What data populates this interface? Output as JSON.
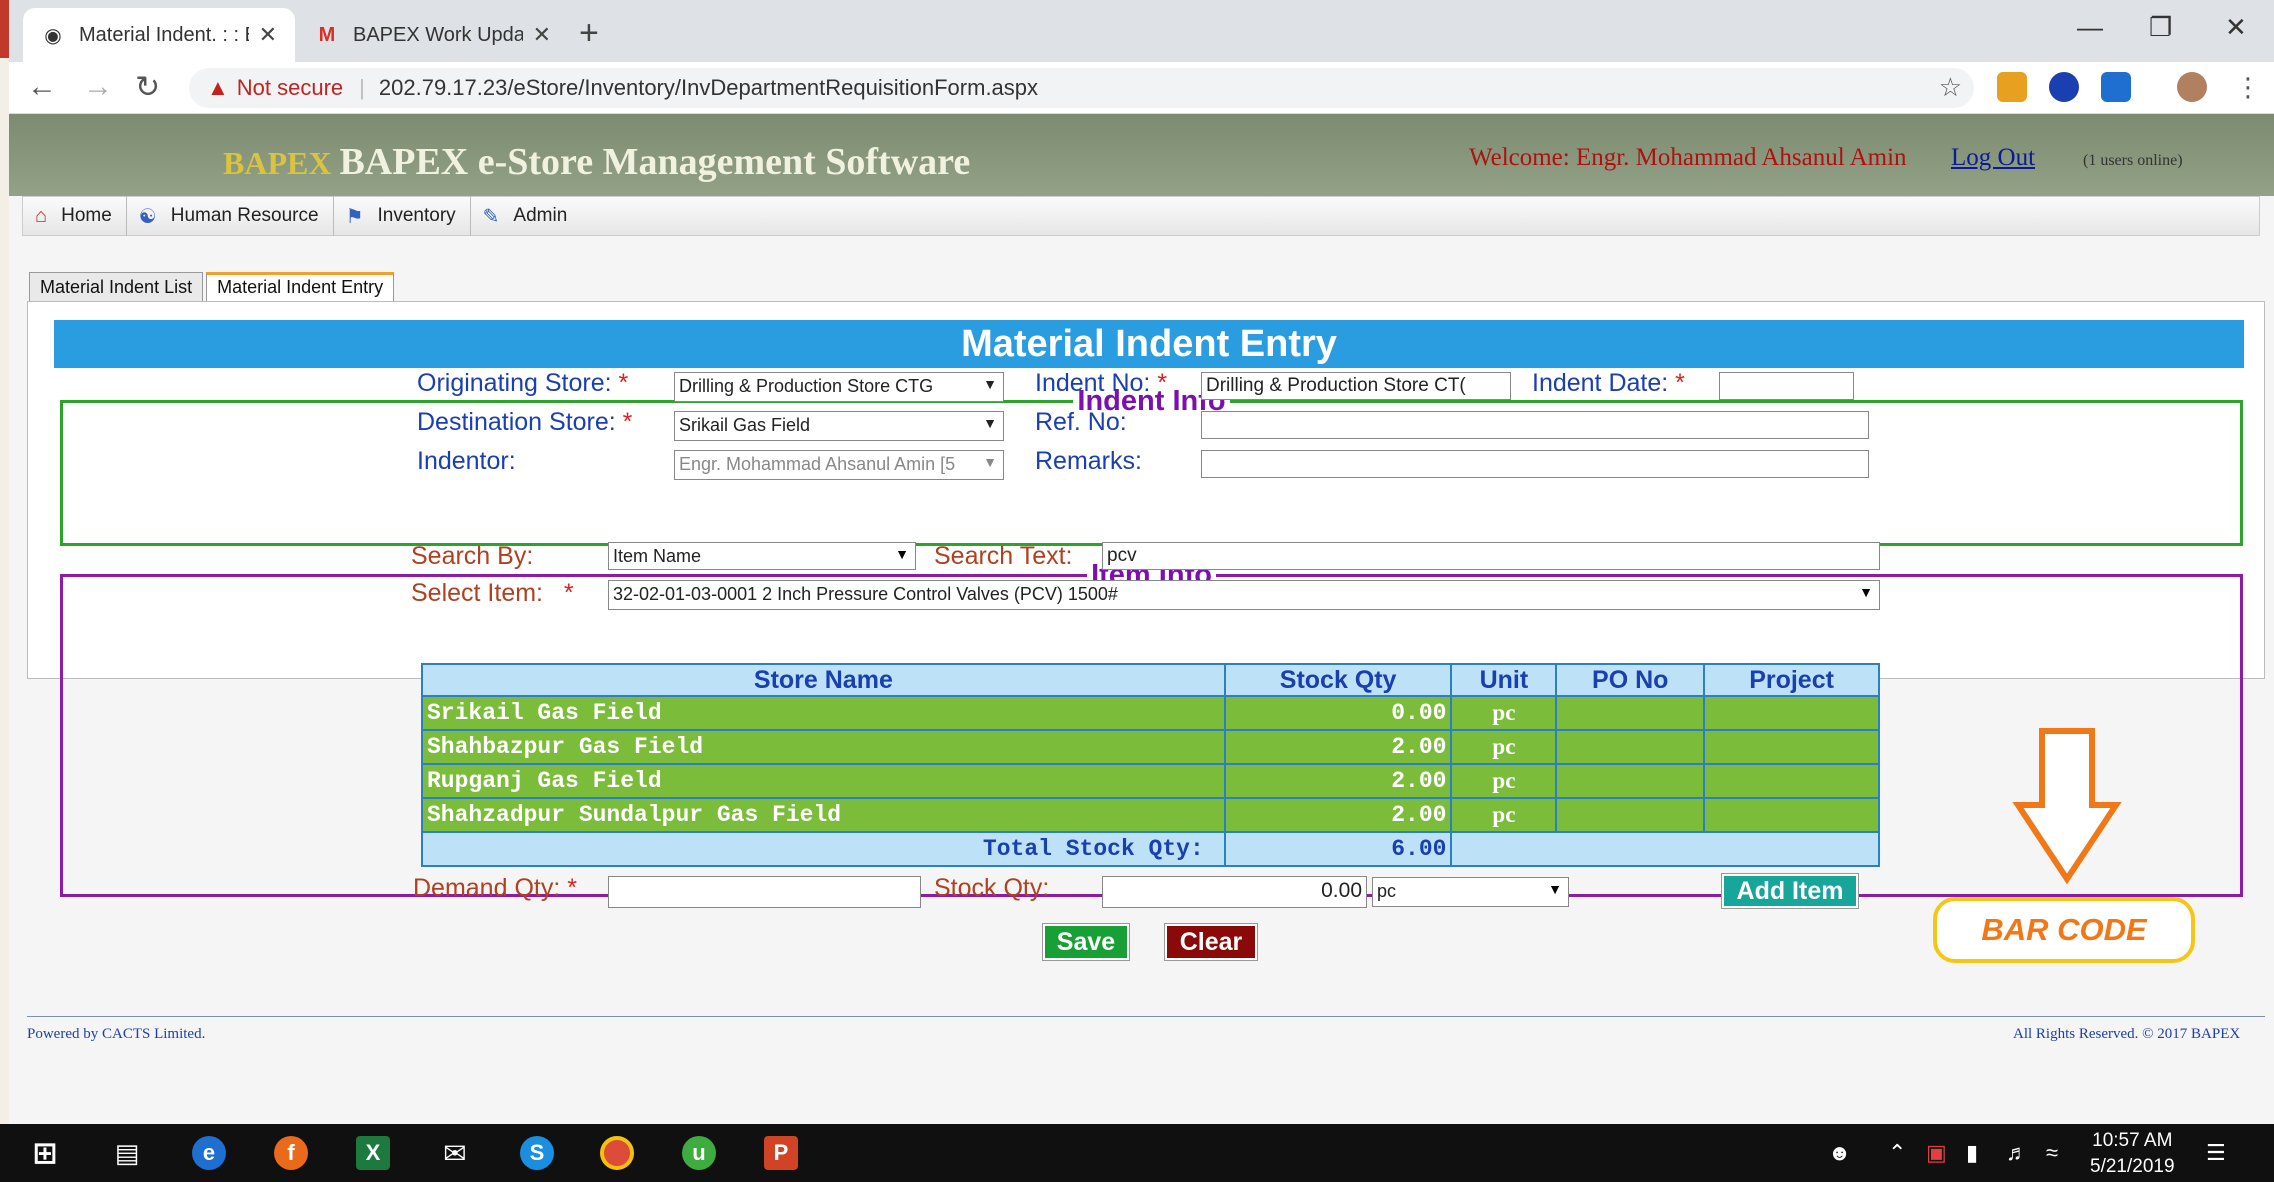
{
  "browser": {
    "tabs": [
      {
        "title": "Material Indent. : : BAPEX e-Store",
        "active": true
      },
      {
        "title": "BAPEX Work Update - ahsanbape",
        "active": false
      }
    ],
    "security_label": "Not secure",
    "url": "202.79.17.23/eStore/Inventory/InvDepartmentRequisitionForm.aspx"
  },
  "header": {
    "logo_mark": "BAPEX",
    "app_title": "BAPEX e-Store Management Software",
    "welcome": "Welcome: Engr. Mohammad Ahsanul Amin",
    "logout": "Log Out",
    "online": "(1 users online)"
  },
  "menu": [
    {
      "label": "Home",
      "icon": "home-icon"
    },
    {
      "label": "Human Resource",
      "icon": "hr-icon"
    },
    {
      "label": "Inventory",
      "icon": "inventory-icon"
    },
    {
      "label": "Admin",
      "icon": "admin-icon"
    }
  ],
  "page_tabs": [
    "Material Indent List",
    "Material Indent Entry"
  ],
  "form_title": "Material Indent Entry",
  "indent_info": {
    "legend": "Indent Info",
    "originating_store_label": "Originating Store:",
    "originating_store_value": "Drilling & Production Store CTG",
    "destination_store_label": "Destination Store:",
    "destination_store_value": "Srikail Gas Field",
    "indentor_label": "Indentor:",
    "indentor_value": "Engr. Mohammad Ahsanul Amin [5",
    "indent_no_label": "Indent No:",
    "indent_no_value": "Drilling & Production Store CT(",
    "ref_no_label": "Ref. No:",
    "ref_no_value": "",
    "remarks_label": "Remarks:",
    "remarks_value": "",
    "indent_date_label": "Indent Date:",
    "indent_date_value": "",
    "required_mark": "*"
  },
  "item_info": {
    "legend": "Item Info",
    "search_by_label": "Search By:",
    "search_by_value": "Item Name",
    "search_text_label": "Search Text:",
    "search_text_value": "pcv",
    "select_item_label": "Select Item:",
    "select_item_value": "32-02-01-03-0001  2 Inch Pressure Control  Valves (PCV) 1500#",
    "columns": [
      "Store Name",
      "Stock Qty",
      "Unit",
      "PO No",
      "Project"
    ],
    "rows": [
      {
        "store": "Srikail Gas Field",
        "qty": "0.00",
        "unit": "pc",
        "po": "",
        "project": ""
      },
      {
        "store": "Shahbazpur Gas Field",
        "qty": "2.00",
        "unit": "pc",
        "po": "",
        "project": ""
      },
      {
        "store": "Rupganj Gas Field",
        "qty": "2.00",
        "unit": "pc",
        "po": "",
        "project": ""
      },
      {
        "store": "Shahzadpur Sundalpur Gas Field",
        "qty": "2.00",
        "unit": "pc",
        "po": "",
        "project": ""
      }
    ],
    "total_label": "Total Stock Qty:",
    "total_value": "6.00",
    "demand_qty_label": "Demand Qty:",
    "demand_qty_value": "",
    "stock_qty_label": "Stock Qty:",
    "stock_qty_value": "0.00",
    "unit_value": "pc",
    "add_item_label": "Add Item"
  },
  "actions": {
    "save": "Save",
    "clear": "Clear"
  },
  "annotation": {
    "label": "BAR CODE",
    "color": "#f07818"
  },
  "footer": {
    "powered": "Powered by CACTS Limited.",
    "rights": "All Rights Reserved. © 2017 BAPEX"
  },
  "taskbar": {
    "time": "10:57 AM",
    "date": "5/21/2019"
  }
}
